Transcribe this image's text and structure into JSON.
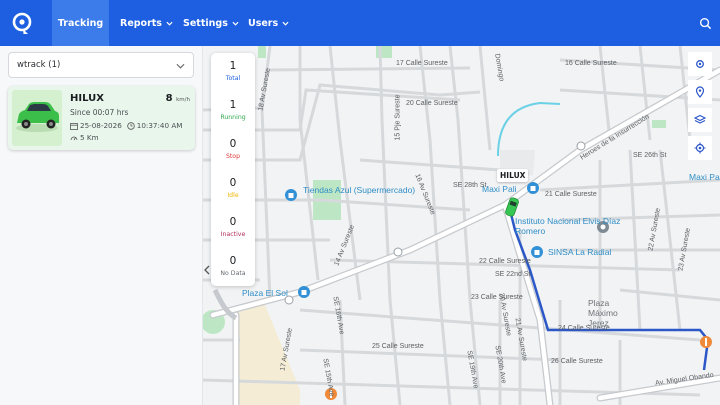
{
  "nav": {
    "items": [
      {
        "label": "Tracking",
        "active": true
      },
      {
        "label": "Reports"
      },
      {
        "label": "Settings"
      },
      {
        "label": "Users"
      }
    ],
    "brand_color": "#1d5fe0"
  },
  "sidebar": {
    "group_select": "wtrack (1)",
    "vehicle": {
      "name": "HILUX",
      "speed": "8",
      "speed_unit": "km/h",
      "since": "Since 00:07 hrs",
      "date": "25-08-2026",
      "time": "10:37:40 AM",
      "distance": "5 Km",
      "status_color": "#37c653"
    }
  },
  "status_panel": [
    {
      "count": "1",
      "label": "Total",
      "color": "#1d5fe0"
    },
    {
      "count": "1",
      "label": "Running",
      "color": "#2fa84f"
    },
    {
      "count": "0",
      "label": "Stop",
      "color": "#e03a3a"
    },
    {
      "count": "0",
      "label": "Idle",
      "color": "#f0b400"
    },
    {
      "count": "0",
      "label": "Inactive",
      "color": "#b0305a"
    },
    {
      "count": "0",
      "label": "No Data",
      "color": "#666b70"
    }
  ],
  "map": {
    "vehicle_tag": "HILUX",
    "pois": [
      "Tiendas Azul (Supermercado)",
      "Maxi Pali",
      "Instituto Nacional Elvis Díaz Romero",
      "SINSA La Radial",
      "Plaza Máximo Jerez",
      "Plaza El Sol",
      "Maxi Pali"
    ],
    "streets": [
      "17 Calle Sureste",
      "20 Calle Sureste",
      "15 Pje Sureste",
      "18 Av Sureste",
      "14 Av Sureste",
      "SE 28th St",
      "16 Av Sureste",
      "Heroes de la Insurrección",
      "21 Calle Sureste",
      "22 Calle Sureste",
      "SE 22nd St",
      "23 Calle Sureste",
      "24 Calle Sureste",
      "25 Calle Sureste",
      "26 Calle Sureste",
      "17 Av Sureste",
      "SE 16th Ave",
      "SE 15th Ave",
      "SE 19th Ave",
      "SE 20th Ave",
      "20 Av Sureste",
      "21 Av Sureste",
      "22 Av Sureste",
      "23 Av Sureste",
      "Av. Miguel Obando",
      "Domingo",
      "16 Calle Sureste",
      "SE 26th St"
    ],
    "controls": [
      "settings-icon",
      "location-pin-icon",
      "layers-icon",
      "gps-target-icon"
    ]
  }
}
